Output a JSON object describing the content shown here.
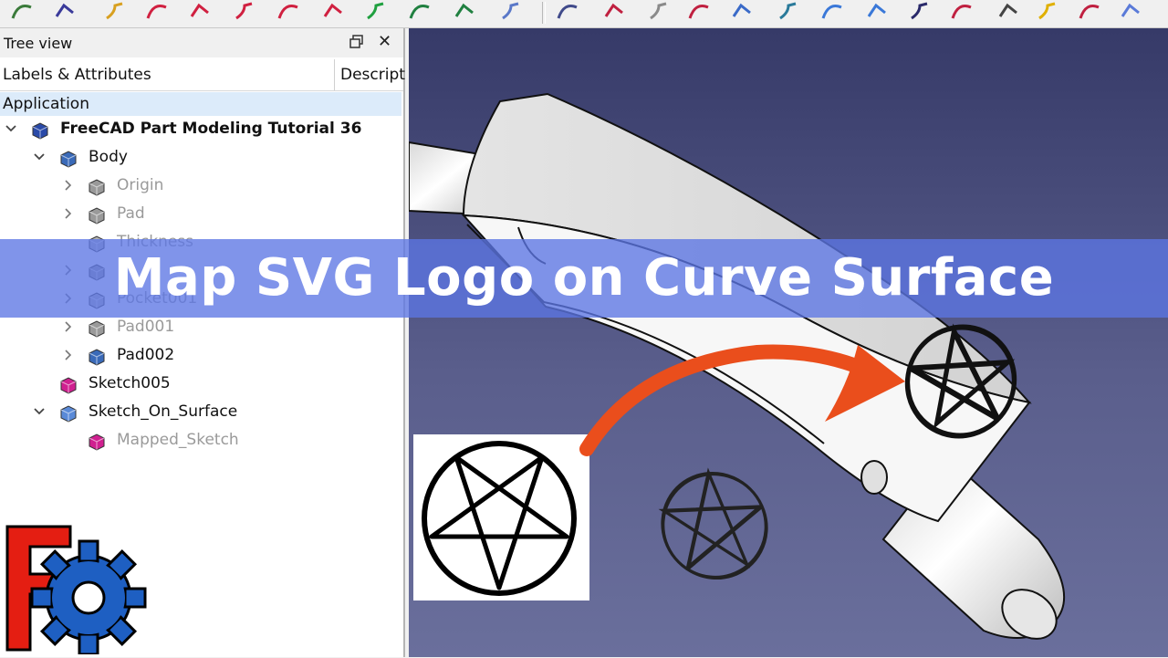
{
  "toolbar": {
    "icons": [
      "line-tool-icon",
      "polyline-tool-icon",
      "curve-tool-icon",
      "bspline-tool-icon",
      "bspline-tool-icon",
      "bspline-tool-icon",
      "bspline-tool-icon",
      "bspline-tool-icon",
      "bspline-tool-icon",
      "arc-tool-icon",
      "conic-tool-icon",
      "surface-tool-icon",
      "gordon-surface-icon",
      "blend-surface-icon",
      "sweep-icon",
      "boolean-icon",
      "extrude-icon",
      "loft-icon",
      "pipe-icon",
      "fillet-icon",
      "filling-icon",
      "net-icon",
      "helix-icon",
      "sphere-icon",
      "part-design-icon",
      "workbench-icon"
    ]
  },
  "tree": {
    "title": "Tree view",
    "col_labels": "Labels & Attributes",
    "col_description": "Descript",
    "application": "Application",
    "items": [
      {
        "label": "FreeCAD Part Modeling Tutorial 36",
        "style": "bold",
        "indent": 0,
        "arrow": "down",
        "icon": "document-icon"
      },
      {
        "label": "Body",
        "style": "normal",
        "indent": 1,
        "arrow": "down",
        "icon": "body-icon"
      },
      {
        "label": "Origin",
        "style": "grey",
        "indent": 2,
        "arrow": "right",
        "icon": "origin-icon"
      },
      {
        "label": "Pad",
        "style": "grey",
        "indent": 2,
        "arrow": "right",
        "icon": "pad-icon"
      },
      {
        "label": "Thickness",
        "style": "grey",
        "indent": 2,
        "arrow": "none",
        "icon": "thickness-icon"
      },
      {
        "label": "",
        "style": "grey",
        "indent": 2,
        "arrow": "right",
        "icon": "pad-icon"
      },
      {
        "label": "Pocket001",
        "style": "grey",
        "indent": 2,
        "arrow": "right",
        "icon": "pocket-icon"
      },
      {
        "label": "Pad001",
        "style": "grey",
        "indent": 2,
        "arrow": "right",
        "icon": "pad-icon"
      },
      {
        "label": "Pad002",
        "style": "normal",
        "indent": 2,
        "arrow": "right",
        "icon": "pad-active-icon"
      },
      {
        "label": "Sketch005",
        "style": "normal",
        "indent": 1,
        "arrow": "none",
        "icon": "sketch-icon"
      },
      {
        "label": "Sketch_On_Surface",
        "style": "normal",
        "indent": 1,
        "arrow": "down",
        "icon": "sketch-on-surface-icon"
      },
      {
        "label": "Mapped_Sketch",
        "style": "grey",
        "indent": 2,
        "arrow": "none",
        "icon": "sketch-icon"
      }
    ]
  },
  "banner": {
    "text": "Map SVG Logo on Curve Surface"
  },
  "colors": {
    "banner": "#5c76e4",
    "arrow": "#ea4e1c",
    "selection": "#dcebfa",
    "viewport_top": "#363a68",
    "viewport_bottom": "#6a6f9c"
  }
}
